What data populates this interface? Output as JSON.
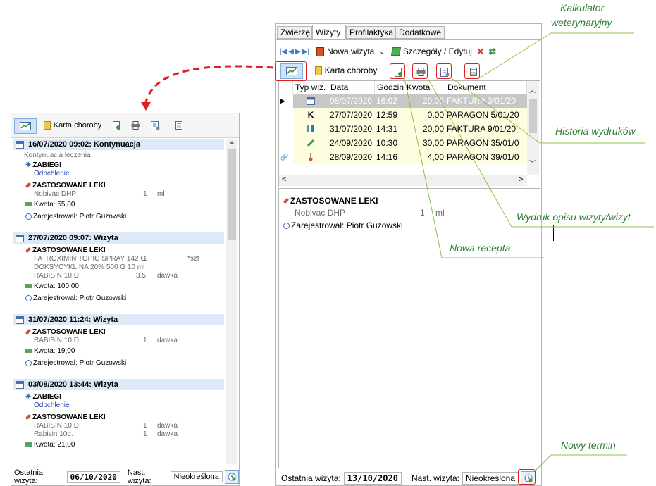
{
  "left_panel": {
    "toolbar": {
      "karta_label": "Karta choroby"
    },
    "visits": [
      {
        "header": "16/07/2020 09:02: Kontynuacja",
        "lines": [
          {
            "kind": "note",
            "text": "Kontynuacja leczenia"
          },
          {
            "kind": "section-zab",
            "text": "ZABIEGI"
          },
          {
            "kind": "blue",
            "text": "Odpchlenie"
          },
          {
            "kind": "section-lek",
            "text": "ZASTOSOWANE LEKI"
          },
          {
            "kind": "drug",
            "name": "Nobivac DHP",
            "qty": "1",
            "unit": "ml"
          },
          {
            "kind": "kwota",
            "text": "Kwota: 55,00"
          },
          {
            "kind": "user",
            "text": "Zarejestrował: Piotr Guzowski"
          }
        ]
      },
      {
        "header": "27/07/2020 09:07: Wizyta",
        "lines": [
          {
            "kind": "section-lek",
            "text": "ZASTOSOWANE LEKI"
          },
          {
            "kind": "drug",
            "name": "FATROXIMIN TOPIC SPRAY 142 G",
            "qty": "1",
            "unit": "*szt"
          },
          {
            "kind": "drug",
            "name": "DOKSYCYKLINA  20%  500 G 10  ml",
            "qty": "",
            "unit": ""
          },
          {
            "kind": "drug",
            "name": "RABISIN  10 D",
            "qty": "3,5",
            "unit": "dawka"
          },
          {
            "kind": "kwota",
            "text": "Kwota: 100,00"
          },
          {
            "kind": "user",
            "text": "Zarejestrował: Piotr Guzowski"
          }
        ]
      },
      {
        "header": "31/07/2020 11:24: Wizyta",
        "lines": [
          {
            "kind": "section-lek",
            "text": "ZASTOSOWANE LEKI"
          },
          {
            "kind": "drug",
            "name": "RABISIN  10 D",
            "qty": "1",
            "unit": "dawka"
          },
          {
            "kind": "kwota",
            "text": "Kwota: 19,00"
          },
          {
            "kind": "user",
            "text": "Zarejestrował: Piotr Guzowski"
          }
        ]
      },
      {
        "header": "03/08/2020 13:44: Wizyta",
        "lines": [
          {
            "kind": "section-zab",
            "text": "ZABIEGI"
          },
          {
            "kind": "blue",
            "text": "Odpchlenie"
          },
          {
            "kind": "section-lek",
            "text": "ZASTOSOWANE LEKI"
          },
          {
            "kind": "drug",
            "name": "RABISIN  10 D",
            "qty": "1",
            "unit": "dawka"
          },
          {
            "kind": "drug",
            "name": "Rabisin 10d.",
            "qty": "1",
            "unit": "dawka"
          },
          {
            "kind": "kwota",
            "text": "Kwota: 21,00"
          }
        ]
      }
    ],
    "footer": {
      "last_label": "Ostatnia wizyta:",
      "last_value": "06/10/2020",
      "next_label": "Nast. wizyta:",
      "next_value": "Nieokreślona"
    }
  },
  "right_panel": {
    "tabs": [
      {
        "label": "Zwierzę",
        "active": false
      },
      {
        "label": "Wizyty",
        "active": true
      },
      {
        "label": "Profilaktyka",
        "active": false
      },
      {
        "label": "Dodatkowe",
        "active": false
      }
    ],
    "toolbar1": {
      "new_visit": "Nowa wizyta",
      "details": "Szczegóły / Edytuj"
    },
    "toolbar2": {
      "karta_label": "Karta choroby"
    },
    "grid": {
      "columns": [
        "Typ wiz.",
        "Data",
        "Godzina",
        "Kwota",
        "Dokument"
      ],
      "rows": [
        {
          "type_icon": "calendar",
          "type_text": "",
          "data": "08/07/2020",
          "godzina": "16:02",
          "kwota": "29,00",
          "dokument": "FAKTURA 3/01/20",
          "selected": true
        },
        {
          "type_icon": "",
          "type_text": "K",
          "data": "27/07/2020",
          "godzina": "12:59",
          "kwota": "0,00",
          "dokument": "PARAGON 5/01/20",
          "selected": false
        },
        {
          "type_icon": "vials",
          "type_text": "",
          "data": "31/07/2020",
          "godzina": "14:31",
          "kwota": "20,00",
          "dokument": "FAKTURA 9/01/20",
          "selected": false
        },
        {
          "type_icon": "syringe",
          "type_text": "",
          "data": "24/09/2020",
          "godzina": "10:30",
          "kwota": "30,00",
          "dokument": "PARAGON 35/01/0",
          "selected": false
        },
        {
          "type_icon": "thermometer",
          "type_text": "",
          "data": "28/09/2020",
          "godzina": "14:16",
          "kwota": "4,00",
          "dokument": "PARAGON 39/01/0",
          "selected": false
        }
      ]
    },
    "detail": {
      "section": "ZASTOSOWANE LEKI",
      "drug_name": "Nobivac DHP",
      "drug_qty": "1",
      "drug_unit": "ml",
      "user": "Zarejestrował: Piotr Guzowski"
    },
    "footer": {
      "last_label": "Ostatnia wizyta:",
      "last_value": "13/10/2020",
      "next_label": "Nast. wizyta:",
      "next_value": "Nieokreślona"
    }
  },
  "callouts": {
    "kalkulator": "Kalkulator\nweterynaryjny",
    "historia": "Historia wydruków",
    "wydruk": "Wydruk opisu wizyty/wizyt",
    "recepta": "Nowa recepta",
    "termin": "Nowy termin"
  },
  "colors": {
    "callout_text": "#2e7d32",
    "callout_line": "#8bc34a",
    "highlight": "#e02020",
    "row_yellow": "#fffde0",
    "row_selected": "#c7c7c7"
  }
}
